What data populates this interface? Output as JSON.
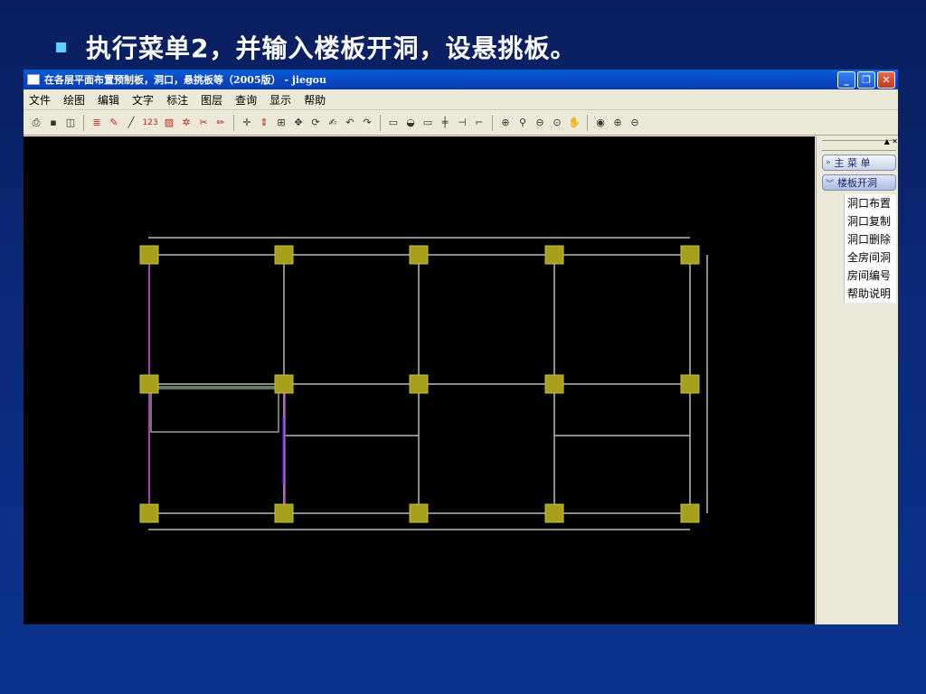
{
  "slide": {
    "title": "执行菜单2，并输入楼板开洞，设悬挑板。"
  },
  "window": {
    "title": "在各层平面布置预制板，洞口，悬挑板等（2005版） - jiegou",
    "buttons": {
      "minimize": "_",
      "restore": "❐",
      "close": "✕"
    }
  },
  "menubar": {
    "items": [
      "文件",
      "绘图",
      "编辑",
      "文字",
      "标注",
      "图层",
      "查询",
      "显示",
      "帮助"
    ]
  },
  "toolbar": {
    "text_tool": "123",
    "icons": [
      "print-icon",
      "save-icon",
      "preview-icon",
      "layer-icon",
      "brush-icon",
      "line-icon",
      "number-text-icon",
      "hatch-icon",
      "style-icon",
      "cut-icon",
      "pencil-icon",
      "crosshair-icon",
      "pan-arrows-icon",
      "array-icon",
      "move-icon",
      "rotate-icon",
      "edit-icon",
      "undo-icon",
      "redo-icon",
      "page-icon",
      "shape-icon",
      "rect-icon",
      "trim-icon",
      "extend-icon",
      "fillet-icon",
      "zoom-window-icon",
      "zoom-realtime-icon",
      "zoom-previous-icon",
      "zoom-extent-icon",
      "pan-icon",
      "zoom-all-icon",
      "zoom-in-icon",
      "zoom-out-icon"
    ]
  },
  "panel": {
    "main_menu": "主 菜 单",
    "section": "楼板开洞",
    "items": [
      "洞口布置",
      "洞口复制",
      "洞口删除",
      "全房间洞",
      "房间编号",
      "帮助说明"
    ],
    "controls": "▲ ✕"
  },
  "colors": {
    "column_fill": "#a59f1c",
    "beam_line": "#b9b9b9",
    "magenta_beam": "#c23ac2",
    "blue_beam": "#2b2bd0",
    "slab_outline": "#9a9a9a"
  },
  "drawing": {
    "columns_rows": 3,
    "columns_cols": 5
  }
}
